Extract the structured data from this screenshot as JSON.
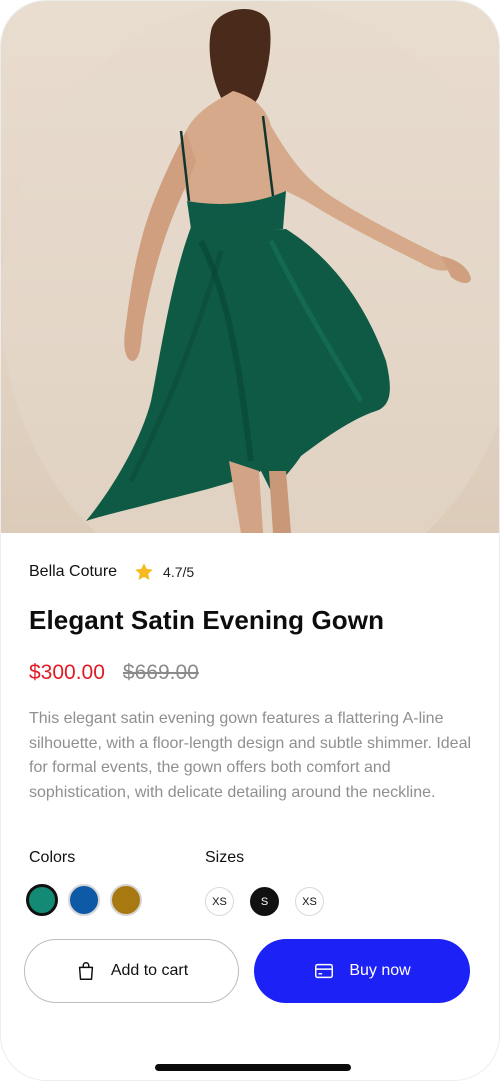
{
  "product": {
    "brand": "Bella Coture",
    "rating": "4.7/5",
    "title": "Elegant Satin Evening Gown",
    "price": "$300.00",
    "old_price": "$669.00",
    "description": "This elegant satin evening gown features a flattering A-line silhouette, with a floor-length design and subtle shimmer. Ideal for formal events, the gown offers both comfort and sophistication, with delicate detailing around the neckline."
  },
  "options": {
    "colors_label": "Colors",
    "sizes_label": "Sizes",
    "colors": [
      "#138a74",
      "#0f5aa6",
      "#a87910"
    ],
    "selected_color": "#138a74",
    "sizes": [
      "XS",
      "S",
      "XS"
    ],
    "selected_size": "S"
  },
  "actions": {
    "add_to_cart": "Add to cart",
    "buy_now": "Buy now"
  },
  "icons": {
    "star": "star-icon",
    "cart": "shopping-bag-icon",
    "buy": "credit-card-icon"
  },
  "theme": {
    "accent": "#1c22f5",
    "price_color": "#e01b24",
    "star_color": "#f6b91e"
  }
}
